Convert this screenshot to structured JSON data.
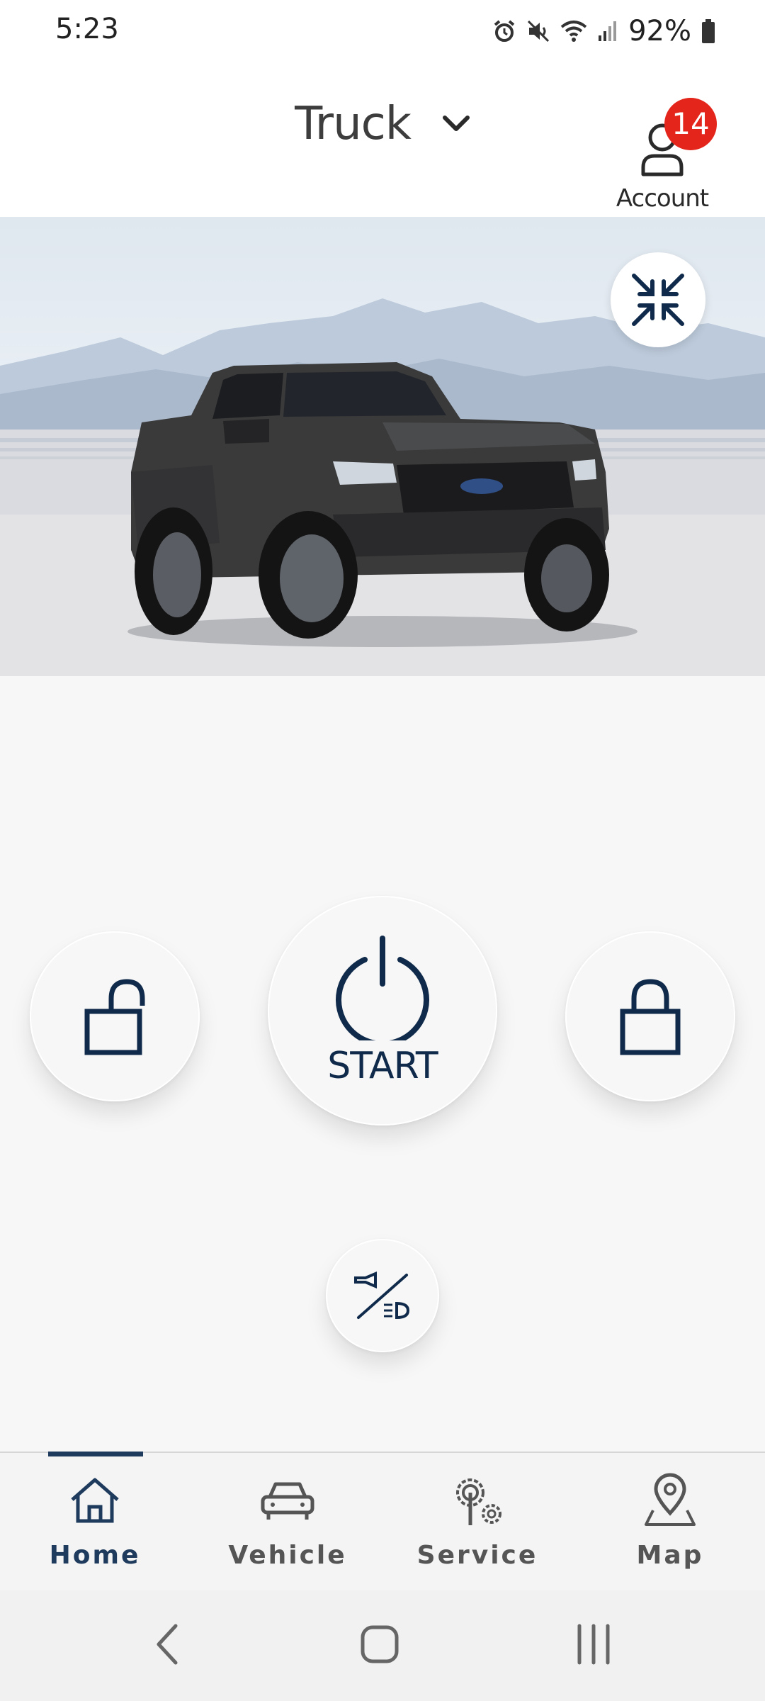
{
  "status_bar": {
    "time": "5:23",
    "battery": "92%",
    "icons": [
      "alarm-icon",
      "mute-icon",
      "wifi-icon",
      "signal-icon",
      "battery-icon"
    ]
  },
  "header": {
    "vehicle_name": "Truck",
    "account_label": "Account",
    "notification_count": "14"
  },
  "hero": {
    "image": "pickup-truck-image",
    "collapse_icon": "collapse-arrows-icon"
  },
  "controls": {
    "start_label": "START",
    "unlock_icon": "unlock-icon",
    "lock_icon": "lock-icon",
    "power_icon": "power-icon",
    "horn_lights_icon": "horn-lights-icon"
  },
  "nav": {
    "items": [
      {
        "label": "Home",
        "icon": "home-icon",
        "active": true
      },
      {
        "label": "Vehicle",
        "icon": "car-icon",
        "active": false
      },
      {
        "label": "Service",
        "icon": "service-gears-icon",
        "active": false
      },
      {
        "label": "Map",
        "icon": "map-pin-icon",
        "active": false
      }
    ]
  },
  "colors": {
    "accent_navy": "#0f2a4a",
    "badge_red": "#e4251b",
    "nav_active": "#1e3a5c"
  }
}
